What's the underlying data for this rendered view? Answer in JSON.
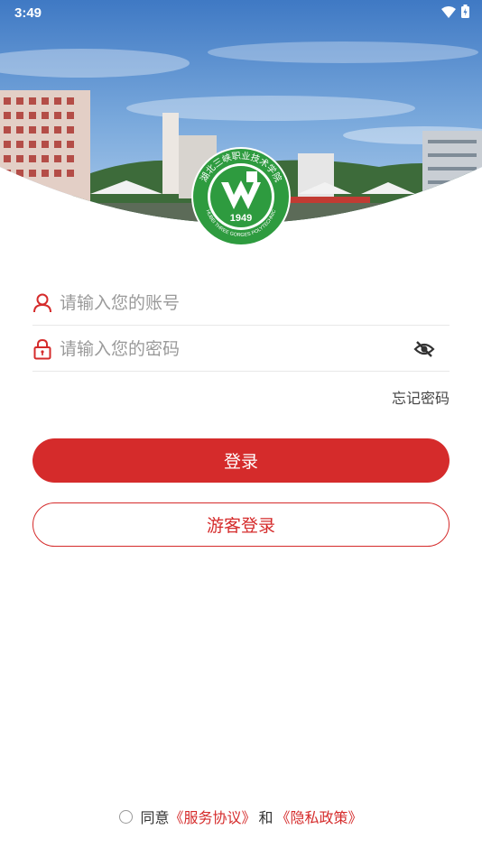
{
  "status_bar": {
    "time": "3:49"
  },
  "logo": {
    "year": "1949",
    "arc_text": "湖北三峡职业技术学院",
    "ring_text": "HUBEI THREE GORGES POLYTECHNIC"
  },
  "form": {
    "account_placeholder": "请输入您的账号",
    "password_placeholder": "请输入您的密码",
    "forgot_label": "忘记密码"
  },
  "actions": {
    "login_label": "登录",
    "guest_label": "游客登录"
  },
  "agreement": {
    "prefix": "同意",
    "service_link": "《服务协议》",
    "conjunction": "和",
    "privacy_link": "《隐私政策》"
  },
  "colors": {
    "accent": "#d52b2b",
    "logo_green": "#2e9b3f"
  }
}
